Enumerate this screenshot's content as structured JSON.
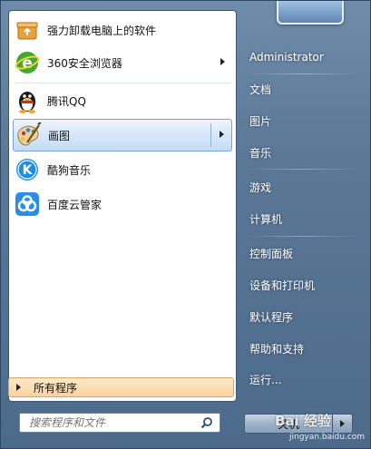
{
  "left_pane": {
    "programs": [
      {
        "label": "强力卸载电脑上的软件",
        "icon": "uninstall-box-icon",
        "has_arrow": false
      },
      {
        "label": "360安全浏览器",
        "icon": "browser-360-icon",
        "has_arrow": true
      },
      {
        "label": "腾讯QQ",
        "icon": "qq-penguin-icon",
        "has_arrow": false
      },
      {
        "label": "画图",
        "icon": "paint-palette-icon",
        "has_arrow": true,
        "selected": true
      },
      {
        "label": "酷狗音乐",
        "icon": "kugou-music-icon",
        "has_arrow": false
      },
      {
        "label": "百度云管家",
        "icon": "baidu-cloud-icon",
        "has_arrow": false
      }
    ],
    "all_programs_label": "所有程序",
    "search_placeholder": "搜索程序和文件"
  },
  "right_pane": {
    "items": [
      {
        "label": "Administrator"
      },
      {
        "label": "文档"
      },
      {
        "label": "图片"
      },
      {
        "label": "音乐"
      },
      {
        "label": "游戏"
      },
      {
        "label": "计算机"
      },
      {
        "label": "控制面板"
      },
      {
        "label": "设备和打印机"
      },
      {
        "label": "默认程序"
      },
      {
        "label": "帮助和支持"
      },
      {
        "label": "运行..."
      }
    ],
    "shutdown_label": "关机"
  },
  "watermark": {
    "main": "Bai 经验",
    "sub": "jingyan.baidu.com"
  },
  "colors": {
    "selection": "#c3dcf7",
    "all_programs": "#fbd49c",
    "menu_frame": "#5b7897"
  }
}
